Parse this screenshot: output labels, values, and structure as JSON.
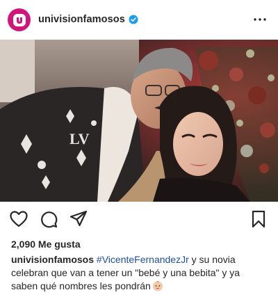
{
  "post": {
    "username": "univisionfamosos",
    "verified": true,
    "brand_color": "#d1167a",
    "more_icon": "more-horizontal-icon"
  },
  "actions": {
    "icons": [
      "heart-icon",
      "comment-icon",
      "share-icon",
      "bookmark-icon"
    ]
  },
  "likes": {
    "label": "2,090 Me gusta"
  },
  "caption": {
    "username": "univisionfamosos",
    "hashtag": "#VicenteFernandezJr",
    "text": " y su novia celebran que van a tener un \"bebé y una bebita\" y ya saben qué nombres les pondrán",
    "emoji": "baby-emoji-icon",
    "hashtag_color": "#1e4f9c"
  }
}
